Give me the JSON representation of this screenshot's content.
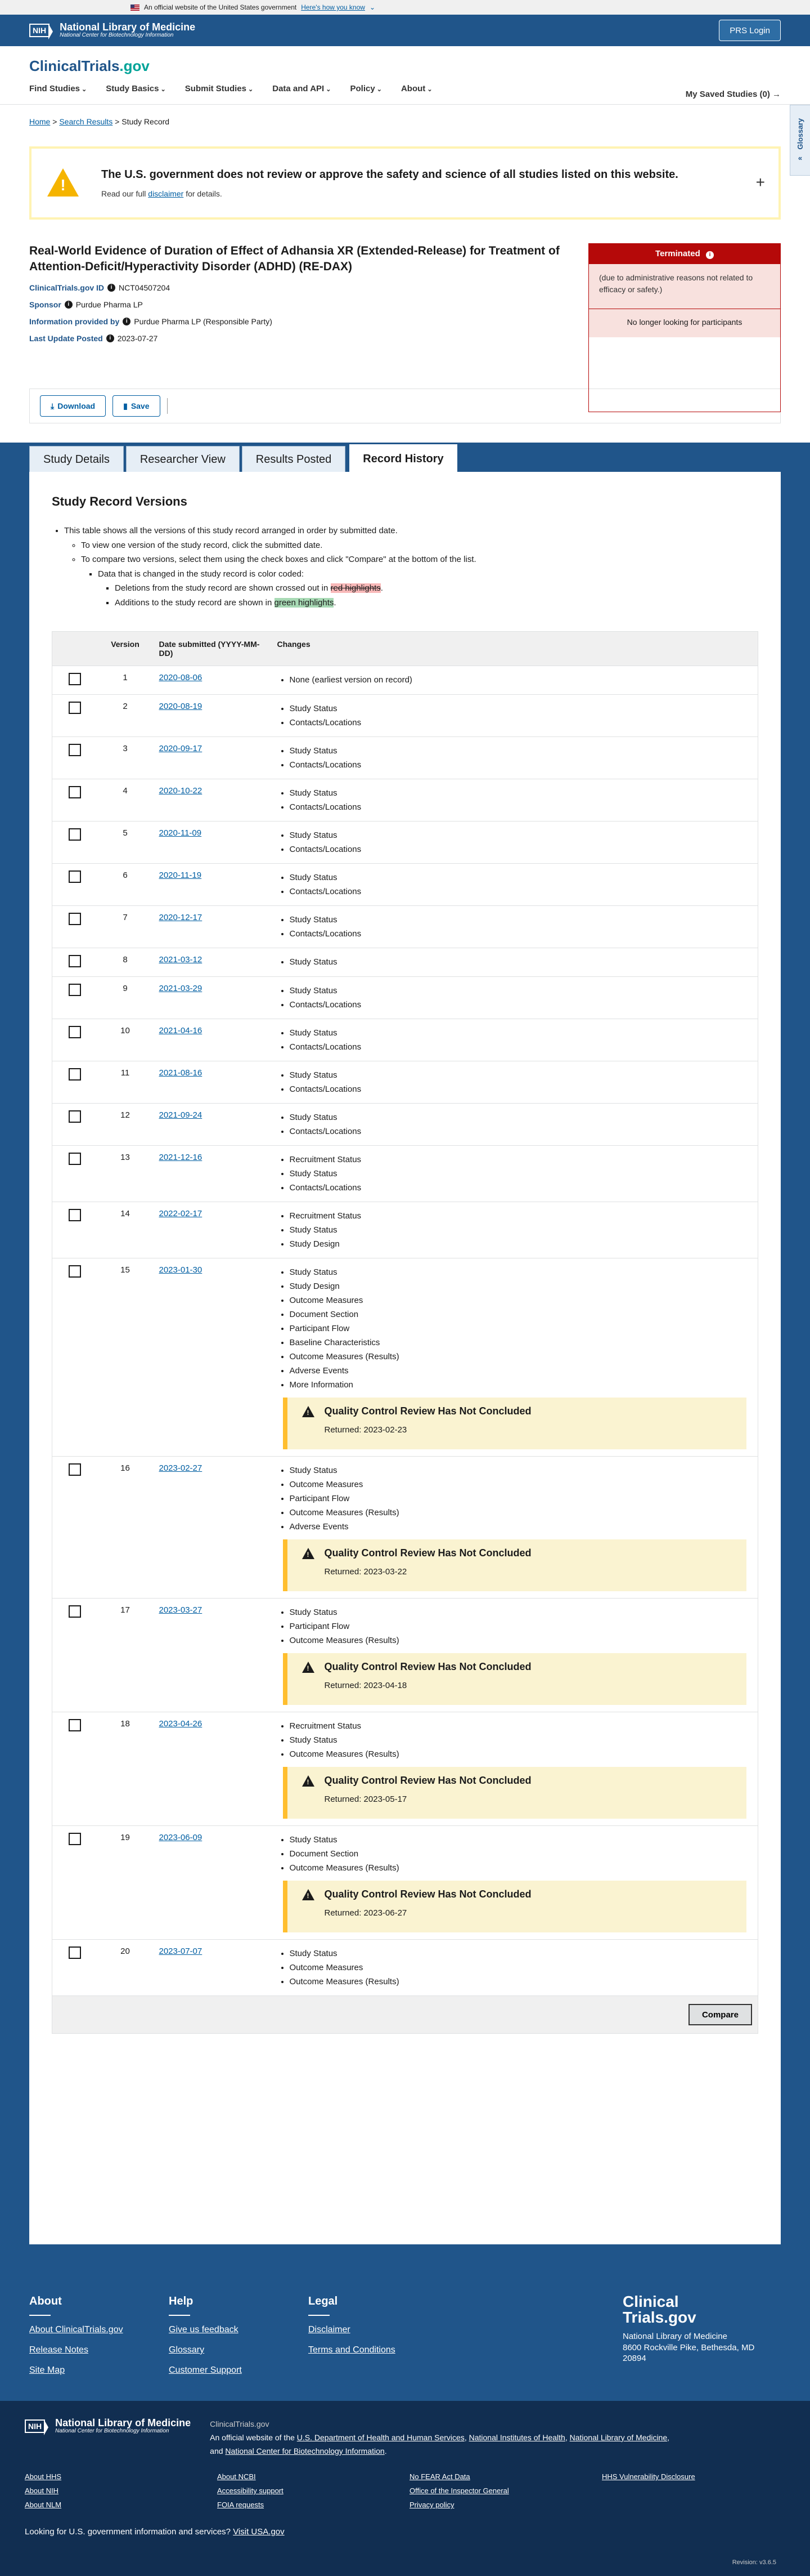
{
  "gov_banner": {
    "text": "An official website of the United States government",
    "how": "Here's how you know"
  },
  "nlm": {
    "nih": "NIH",
    "title": "National Library of Medicine",
    "subtitle": "National Center for Biotechnology Information",
    "prs_login": "PRS Login"
  },
  "site": {
    "title_a": "ClinicalTrials",
    "title_b": ".gov",
    "saved": "My Saved Studies (0) →"
  },
  "nav": [
    "Find Studies",
    "Study Basics",
    "Submit Studies",
    "Data and API",
    "Policy",
    "About"
  ],
  "breadcrumb": {
    "home": "Home",
    "search": "Search Results",
    "current": "Study Record"
  },
  "glossary": "Glossary",
  "alert": {
    "title": "The U.S. government does not review or approve the safety and science of all studies listed on this website.",
    "pre": "Read our full",
    "link": "disclaimer",
    "post": "for details."
  },
  "study": {
    "title": "Real-World Evidence of Duration of Effect of Adhansia XR (Extended-Release) for Treatment of Attention-Deficit/Hyperactivity Disorder (ADHD) (RE-DAX)",
    "id_label": "ClinicalTrials.gov ID",
    "id": "NCT04507204",
    "sponsor_label": "Sponsor",
    "sponsor": "Purdue Pharma LP",
    "info_label": "Information provided by",
    "info": "Purdue Pharma LP (Responsible Party)",
    "update_label": "Last Update Posted",
    "update": "2023-07-27"
  },
  "status": {
    "label": "Terminated",
    "reason": "(due to administrative reasons not related to efficacy or safety.)",
    "recruit": "No longer looking for participants"
  },
  "actions": {
    "download": "Download",
    "save": "Save"
  },
  "tabs": [
    "Study Details",
    "Researcher View",
    "Results Posted",
    "Record History"
  ],
  "history": {
    "heading": "Study Record Versions",
    "intro1": "This table shows all the versions of this study record arranged in order by submitted date.",
    "intro2": "To view one version of the study record, click the submitted date.",
    "intro3": "To compare two versions, select them using the check boxes and click \"Compare\" at the bottom of the list.",
    "intro4": "Data that is changed in the study record is color coded:",
    "intro5a": "Deletions from the study record are shown crossed out in",
    "intro5b": "red highlights",
    "intro6a": "Additions to the study record are shown in",
    "intro6b": "green highlights",
    "col_version": "Version",
    "col_date": "Date submitted (YYYY-MM-DD)",
    "col_changes": "Changes",
    "qc_title": "Quality Control Review Has Not Concluded",
    "compare": "Compare"
  },
  "versions": [
    {
      "v": "1",
      "date": "2020-08-06",
      "changes": [
        "None (earliest version on record)"
      ]
    },
    {
      "v": "2",
      "date": "2020-08-19",
      "changes": [
        "Study Status",
        "Contacts/Locations"
      ]
    },
    {
      "v": "3",
      "date": "2020-09-17",
      "changes": [
        "Study Status",
        "Contacts/Locations"
      ]
    },
    {
      "v": "4",
      "date": "2020-10-22",
      "changes": [
        "Study Status",
        "Contacts/Locations"
      ]
    },
    {
      "v": "5",
      "date": "2020-11-09",
      "changes": [
        "Study Status",
        "Contacts/Locations"
      ]
    },
    {
      "v": "6",
      "date": "2020-11-19",
      "changes": [
        "Study Status",
        "Contacts/Locations"
      ]
    },
    {
      "v": "7",
      "date": "2020-12-17",
      "changes": [
        "Study Status",
        "Contacts/Locations"
      ]
    },
    {
      "v": "8",
      "date": "2021-03-12",
      "changes": [
        "Study Status"
      ]
    },
    {
      "v": "9",
      "date": "2021-03-29",
      "changes": [
        "Study Status",
        "Contacts/Locations"
      ]
    },
    {
      "v": "10",
      "date": "2021-04-16",
      "changes": [
        "Study Status",
        "Contacts/Locations"
      ]
    },
    {
      "v": "11",
      "date": "2021-08-16",
      "changes": [
        "Study Status",
        "Contacts/Locations"
      ]
    },
    {
      "v": "12",
      "date": "2021-09-24",
      "changes": [
        "Study Status",
        "Contacts/Locations"
      ]
    },
    {
      "v": "13",
      "date": "2021-12-16",
      "changes": [
        "Recruitment Status",
        "Study Status",
        "Contacts/Locations"
      ]
    },
    {
      "v": "14",
      "date": "2022-02-17",
      "changes": [
        "Recruitment Status",
        "Study Status",
        "Study Design"
      ]
    },
    {
      "v": "15",
      "date": "2023-01-30",
      "changes": [
        "Study Status",
        "Study Design",
        "Outcome Measures",
        "Document Section",
        "Participant Flow",
        "Baseline Characteristics",
        "Outcome Measures (Results)",
        "Adverse Events",
        "More Information"
      ],
      "qc": "Returned: 2023-02-23"
    },
    {
      "v": "16",
      "date": "2023-02-27",
      "changes": [
        "Study Status",
        "Outcome Measures",
        "Participant Flow",
        "Outcome Measures (Results)",
        "Adverse Events"
      ],
      "qc": "Returned: 2023-03-22"
    },
    {
      "v": "17",
      "date": "2023-03-27",
      "changes": [
        "Study Status",
        "Participant Flow",
        "Outcome Measures (Results)"
      ],
      "qc": "Returned: 2023-04-18"
    },
    {
      "v": "18",
      "date": "2023-04-26",
      "changes": [
        "Recruitment Status",
        "Study Status",
        "Outcome Measures (Results)"
      ],
      "qc": "Returned: 2023-05-17"
    },
    {
      "v": "19",
      "date": "2023-06-09",
      "changes": [
        "Study Status",
        "Document Section",
        "Outcome Measures (Results)"
      ],
      "qc": "Returned: 2023-06-27"
    },
    {
      "v": "20",
      "date": "2023-07-07",
      "changes": [
        "Study Status",
        "Outcome Measures",
        "Outcome Measures (Results)"
      ]
    }
  ],
  "footer": {
    "about": {
      "title": "About",
      "links": [
        "About ClinicalTrials.gov",
        "Release Notes",
        "Site Map"
      ]
    },
    "help": {
      "title": "Help",
      "links": [
        "Give us feedback",
        "Glossary",
        "Customer Support"
      ]
    },
    "legal": {
      "title": "Legal",
      "links": [
        "Disclaimer",
        "Terms and Conditions"
      ]
    },
    "brand": {
      "line1": "Clinical",
      "line2": "Trials.gov",
      "org": "National Library of Medicine",
      "addr1": "8600 Rockville Pike, Bethesda, MD",
      "addr2": "20894"
    }
  },
  "footer2": {
    "site": "ClinicalTrials.gov",
    "official_pre": "An official website of the",
    "hhs": "U.S. Department of Health and Human Services",
    "nih": "National Institutes of Health",
    "nlm": "National Library of Medicine",
    "ncbi": "National Center for Biotechnology Information",
    "links": [
      "About HHS",
      "About NCBI",
      "No FEAR Act Data",
      "HHS Vulnerability Disclosure",
      "About NIH",
      "Accessibility support",
      "Office of the Inspector General",
      "",
      "About NLM",
      "FOIA requests",
      "Privacy policy",
      ""
    ],
    "usagov_pre": "Looking for U.S. government information and services?",
    "usagov_link": "Visit USA.gov",
    "version": "Revision: v3.6.5"
  }
}
